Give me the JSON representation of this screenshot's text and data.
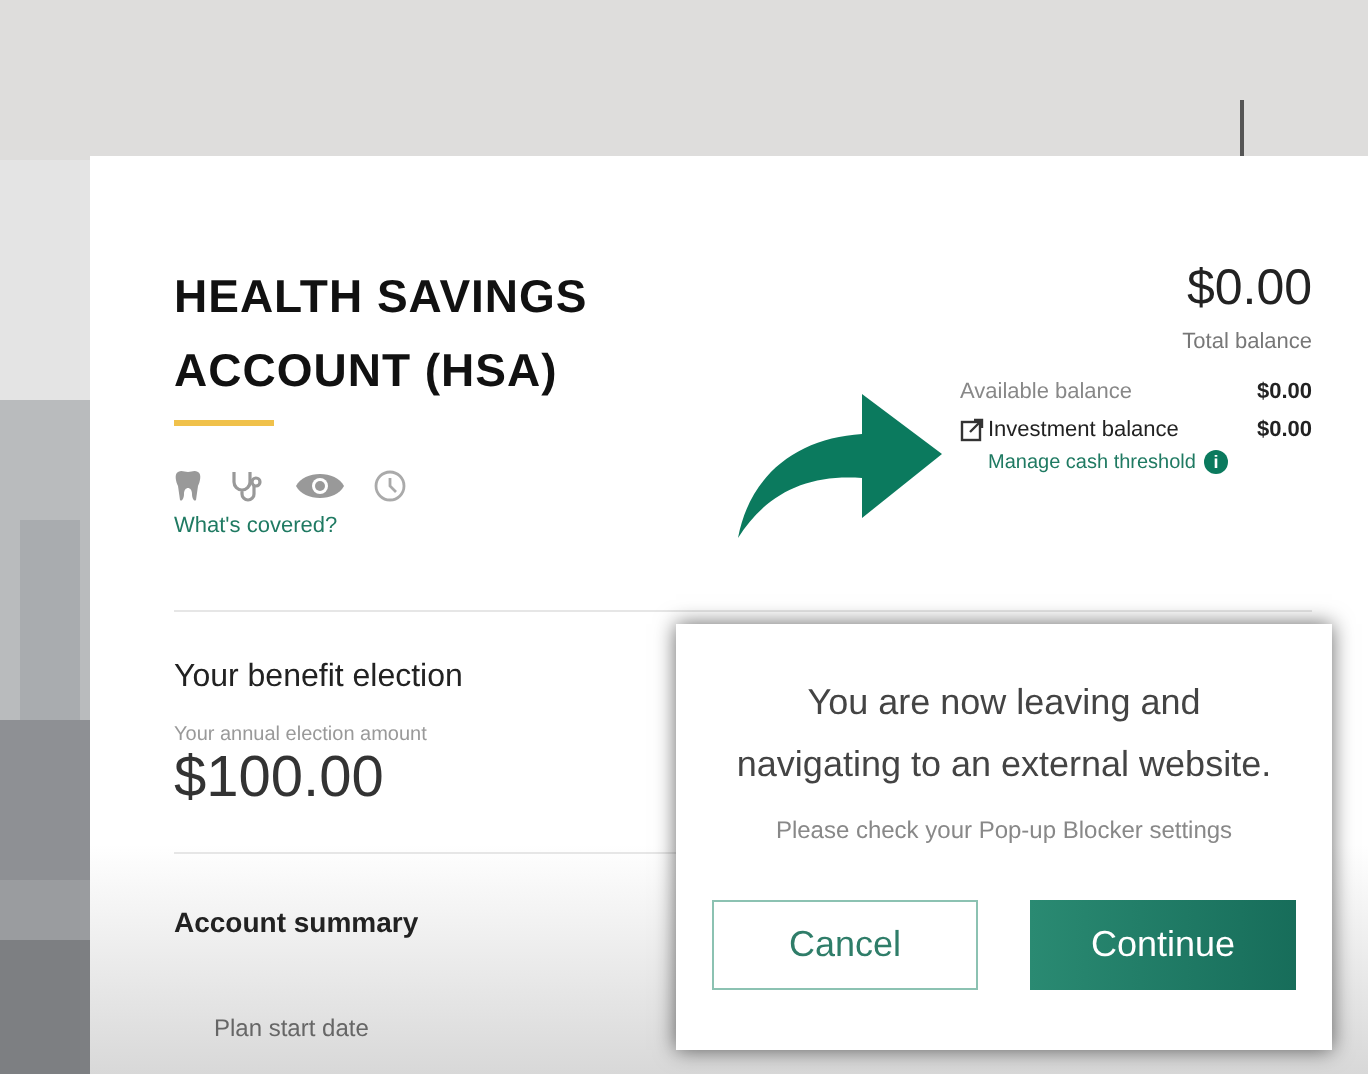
{
  "account": {
    "title_line1": "HEALTH SAVINGS",
    "title_line2": "ACCOUNT (HSA)",
    "coverage_link": "What's covered?"
  },
  "balances": {
    "total": "$0.00",
    "total_label": "Total balance",
    "rows": [
      {
        "label": "Available balance",
        "value": "$0.00",
        "external": false
      },
      {
        "label": "Investment balance",
        "value": "$0.00",
        "external": true
      }
    ],
    "manage_link": "Manage cash threshold",
    "info_icon": "i"
  },
  "benefit": {
    "heading": "Your benefit election",
    "amount_label": "Your annual election amount",
    "amount": "$100.00"
  },
  "summary": {
    "heading": "Account summary",
    "first_row_label": "Plan start date"
  },
  "dialog": {
    "title": "You are now leaving and navigating to an external website.",
    "note": "Please check your Pop-up Blocker settings",
    "buttons": [
      {
        "label": "Cancel",
        "kind": "secondary"
      },
      {
        "label": "Continue",
        "kind": "primary"
      }
    ]
  }
}
